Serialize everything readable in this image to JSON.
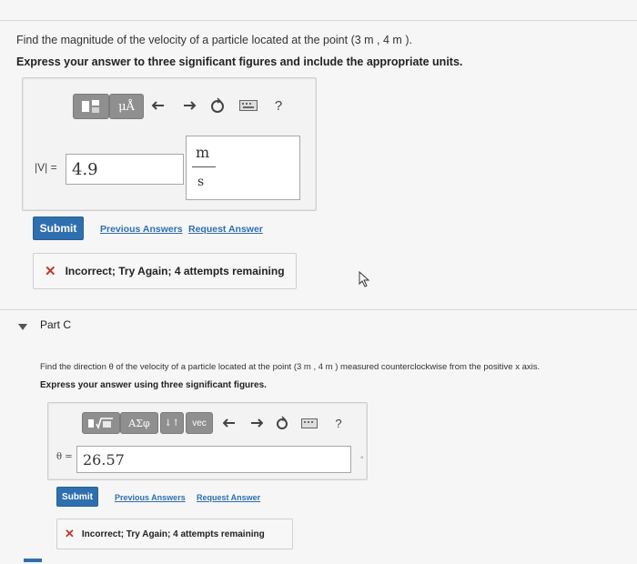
{
  "partB": {
    "question": "Find the magnitude of the velocity of a particle located at the point (3  m , 4  m ).",
    "instruction": "Express your answer to three significant figures and include the appropriate units.",
    "toolbar": {
      "template_btn": "",
      "units_btn": "μÅ",
      "help": "?"
    },
    "var_label": "|V| =",
    "answer_value": "4.9",
    "unit_numerator": "m",
    "unit_denominator": "s",
    "submit": "Submit",
    "previous_answers": "Previous Answers",
    "request_answer": "Request Answer",
    "feedback": "Incorrect; Try Again; 4 attempts remaining"
  },
  "partC": {
    "title": "Part C",
    "question": "Find the direction θ of the velocity of a particle located at the point (3  m , 4  m ) measured counterclockwise from the positive x axis.",
    "instruction": "Express your answer using three significant figures.",
    "toolbar": {
      "greek_btn": "ΑΣφ",
      "arrows_btn": "↓↑",
      "vec_btn": "vec",
      "help": "?"
    },
    "var_label": "θ =",
    "answer_value": "26.57",
    "unit_mark": "°",
    "submit": "Submit",
    "previous_answers": "Previous Answers",
    "request_answer": "Request Answer",
    "feedback": "Incorrect; Try Again; 4 attempts remaining"
  }
}
